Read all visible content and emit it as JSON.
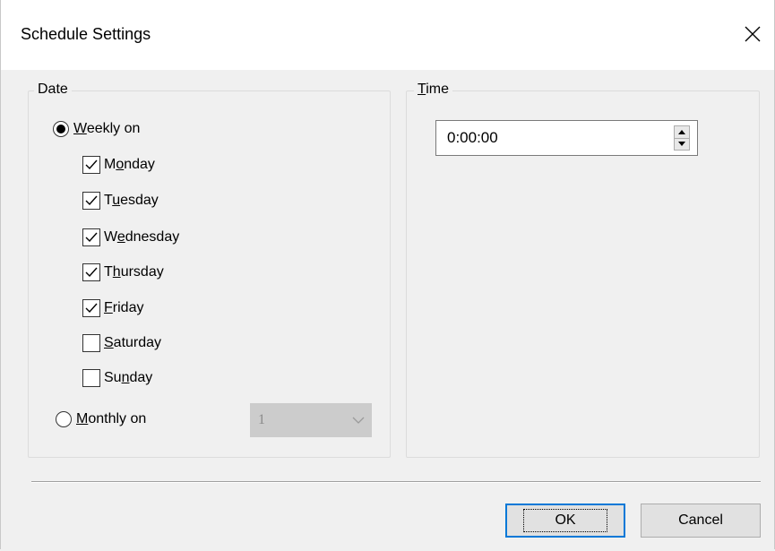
{
  "window": {
    "title": "Schedule Settings"
  },
  "date_group": {
    "legend": "Date",
    "weekly_radio": {
      "label_prefix": "",
      "mnemonic": "W",
      "label_rest": "eekly on",
      "checked": true
    },
    "days": [
      {
        "pre": "M",
        "mnem": "o",
        "post": "nday",
        "checked": true
      },
      {
        "pre": "T",
        "mnem": "u",
        "post": "esday",
        "checked": true
      },
      {
        "pre": "W",
        "mnem": "e",
        "post": "dnesday",
        "checked": true
      },
      {
        "pre": "T",
        "mnem": "h",
        "post": "ursday",
        "checked": true
      },
      {
        "pre": "",
        "mnem": "F",
        "post": "riday",
        "checked": true
      },
      {
        "pre": "",
        "mnem": "S",
        "post": "aturday",
        "checked": false
      },
      {
        "pre": "Su",
        "mnem": "n",
        "post": "day",
        "checked": false
      }
    ],
    "monthly_radio": {
      "label_prefix": "",
      "mnemonic": "M",
      "label_rest": "onthly on",
      "checked": false
    },
    "monthly_day_select": {
      "value": "1",
      "enabled": false
    }
  },
  "time_group": {
    "legend_mnemonic": "T",
    "legend_rest": "ime",
    "time_value": "0:00:00"
  },
  "buttons": {
    "ok": "OK",
    "cancel": "Cancel"
  },
  "colors": {
    "accent": "#0078d7",
    "dialog_bg": "#f0f0f0",
    "titlebar_bg": "#ffffff"
  }
}
